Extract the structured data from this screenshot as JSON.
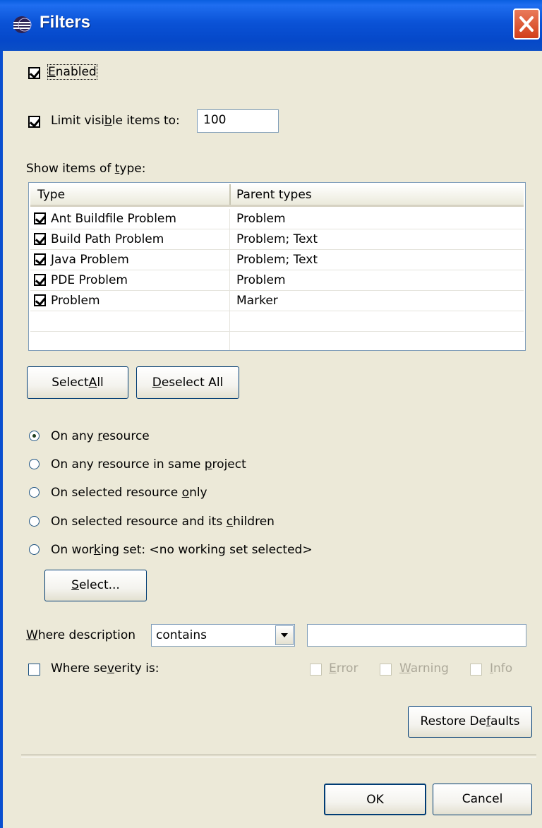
{
  "window": {
    "title": "Filters",
    "icon": "eclipse-icon",
    "close_icon": "close-icon"
  },
  "enabled": {
    "label_pre": "",
    "label_u": "E",
    "label_post": "nabled",
    "checked": true
  },
  "limit": {
    "label_pre": "Limit visi",
    "label_u": "b",
    "label_post": "le items to:",
    "checked": true,
    "value": "100"
  },
  "types_section": {
    "label_pre": "Show items of ",
    "label_u": "t",
    "label_post": "ype:"
  },
  "table": {
    "columns": [
      "Type",
      "Parent types"
    ],
    "rows": [
      {
        "type": "Ant Buildfile Problem",
        "parents": "Problem",
        "checked": true
      },
      {
        "type": "Build Path Problem",
        "parents": "Problem; Text",
        "checked": true
      },
      {
        "type": "Java Problem",
        "parents": "Problem; Text",
        "checked": true
      },
      {
        "type": "PDE Problem",
        "parents": "Problem",
        "checked": true
      },
      {
        "type": "Problem",
        "parents": "Marker",
        "checked": true
      }
    ]
  },
  "buttons": {
    "select_all": {
      "pre": "Select ",
      "u": "A",
      "post": "ll"
    },
    "deselect_all": {
      "pre": "",
      "u": "D",
      "post": "eselect All"
    },
    "select": {
      "pre": "",
      "u": "S",
      "post": "elect..."
    },
    "restore": {
      "pre": "Restore De",
      "u": "f",
      "post": "aults"
    },
    "ok": "OK",
    "cancel": "Cancel"
  },
  "scope": {
    "selected": 0,
    "options": [
      {
        "pre": "On any ",
        "u": "r",
        "post": "esource"
      },
      {
        "pre": "On any resource in same ",
        "u": "p",
        "post": "roject"
      },
      {
        "pre": "On selected resource ",
        "u": "o",
        "post": "nly"
      },
      {
        "pre": "On selected resource and its ",
        "u": "c",
        "post": "hildren"
      },
      {
        "pre": "On wor",
        "u": "k",
        "post": "ing set:  <no working set selected>"
      }
    ]
  },
  "description": {
    "label_pre": "",
    "label_u": "W",
    "label_post": "here description",
    "operator": "contains",
    "text": ""
  },
  "severity": {
    "label_pre": "Where se",
    "label_u": "v",
    "label_post": "erity is:",
    "checked": false,
    "error": {
      "pre": "",
      "u": "E",
      "post": "rror"
    },
    "warning": {
      "pre": "",
      "u": "W",
      "post": "arning"
    },
    "info": {
      "pre": "",
      "u": "I",
      "post": "nfo"
    }
  }
}
